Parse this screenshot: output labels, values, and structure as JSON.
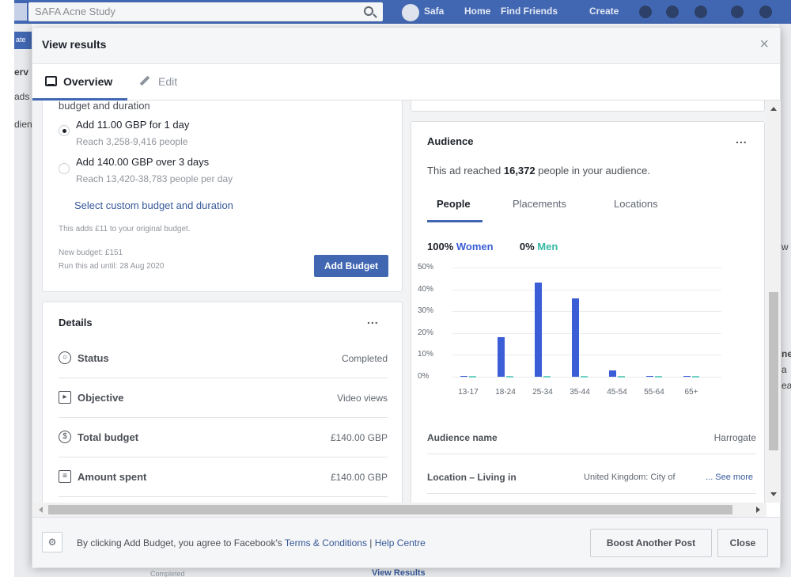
{
  "fb": {
    "search_text": "SAFA Acne Study",
    "user_name": "Safa",
    "nav": [
      "Home",
      "Find Friends",
      "Create"
    ],
    "left_button": "ate",
    "left_labels": [
      "erv",
      "ads",
      "dien"
    ],
    "right_labels": [
      "w",
      "ne",
      "a",
      "ea"
    ]
  },
  "modal": {
    "title": "View results",
    "close_glyph": "×"
  },
  "tabs": {
    "overview": "Overview",
    "edit": "Edit"
  },
  "budget": {
    "heading": "budget and duration",
    "options": [
      {
        "label": "Add 11.00 GBP for 1 day",
        "reach": "Reach 3,258-9,416 people",
        "selected": true
      },
      {
        "label": "Add 140.00 GBP over 3 days",
        "reach": "Reach 13,420-38,783 people per day",
        "selected": false
      }
    ],
    "custom_link": "Select custom budget and duration",
    "note": "This adds £11 to your original budget.",
    "new_budget": "New budget: £151",
    "run_until": "Run this ad until: 28 Aug 2020",
    "add_button": "Add Budget"
  },
  "details": {
    "title": "Details",
    "more": "...",
    "rows": [
      {
        "label": "Status",
        "value": "Completed",
        "icon": "status-circle-icon"
      },
      {
        "label": "Objective",
        "value": "Video views",
        "icon": "play-icon"
      },
      {
        "label": "Total budget",
        "value": "£140.00 GBP",
        "icon": "dollar-icon"
      },
      {
        "label": "Amount spent",
        "value": "£140.00 GBP",
        "icon": "receipt-icon"
      }
    ]
  },
  "audience": {
    "title": "Audience",
    "more": "...",
    "reached_prefix": "This ad reached",
    "reached_count": "16,372",
    "reached_suffix": "people in your audience.",
    "tabs": [
      "People",
      "Placements",
      "Locations"
    ],
    "women_pct": "100%",
    "women_label": "Women",
    "men_pct": "0%",
    "men_label": "Men",
    "women_color": "#3b5ed6",
    "men_color": "#35b8a3",
    "audience_name_label": "Audience name",
    "audience_name_value": "Harrogate",
    "location_label": "Location – Living in",
    "location_value": "United Kingdom: City of",
    "see_more": "... See more"
  },
  "chart_data": {
    "type": "bar",
    "categories": [
      "13-17",
      "18-24",
      "25-34",
      "35-44",
      "45-54",
      "55-64",
      "65+"
    ],
    "series": [
      {
        "name": "Women",
        "values": [
          0.5,
          18,
          43,
          36,
          3,
          0.5,
          0.5
        ]
      },
      {
        "name": "Men",
        "values": [
          0.3,
          0.3,
          0.3,
          0.3,
          0.3,
          0.3,
          0.3
        ]
      }
    ],
    "yticks": [
      "50%",
      "40%",
      "30%",
      "20%",
      "10%",
      "0%"
    ],
    "ylim": [
      0,
      50
    ]
  },
  "footer": {
    "text_prefix": "By clicking Add Budget, you agree to Facebook's",
    "terms_link": "Terms & Conditions",
    "separator": "|",
    "help_link": "Help Centre",
    "boost_button": "Boost Another Post",
    "close_button": "Close"
  },
  "behind": {
    "status": "Completed",
    "view_results": "View Results"
  }
}
